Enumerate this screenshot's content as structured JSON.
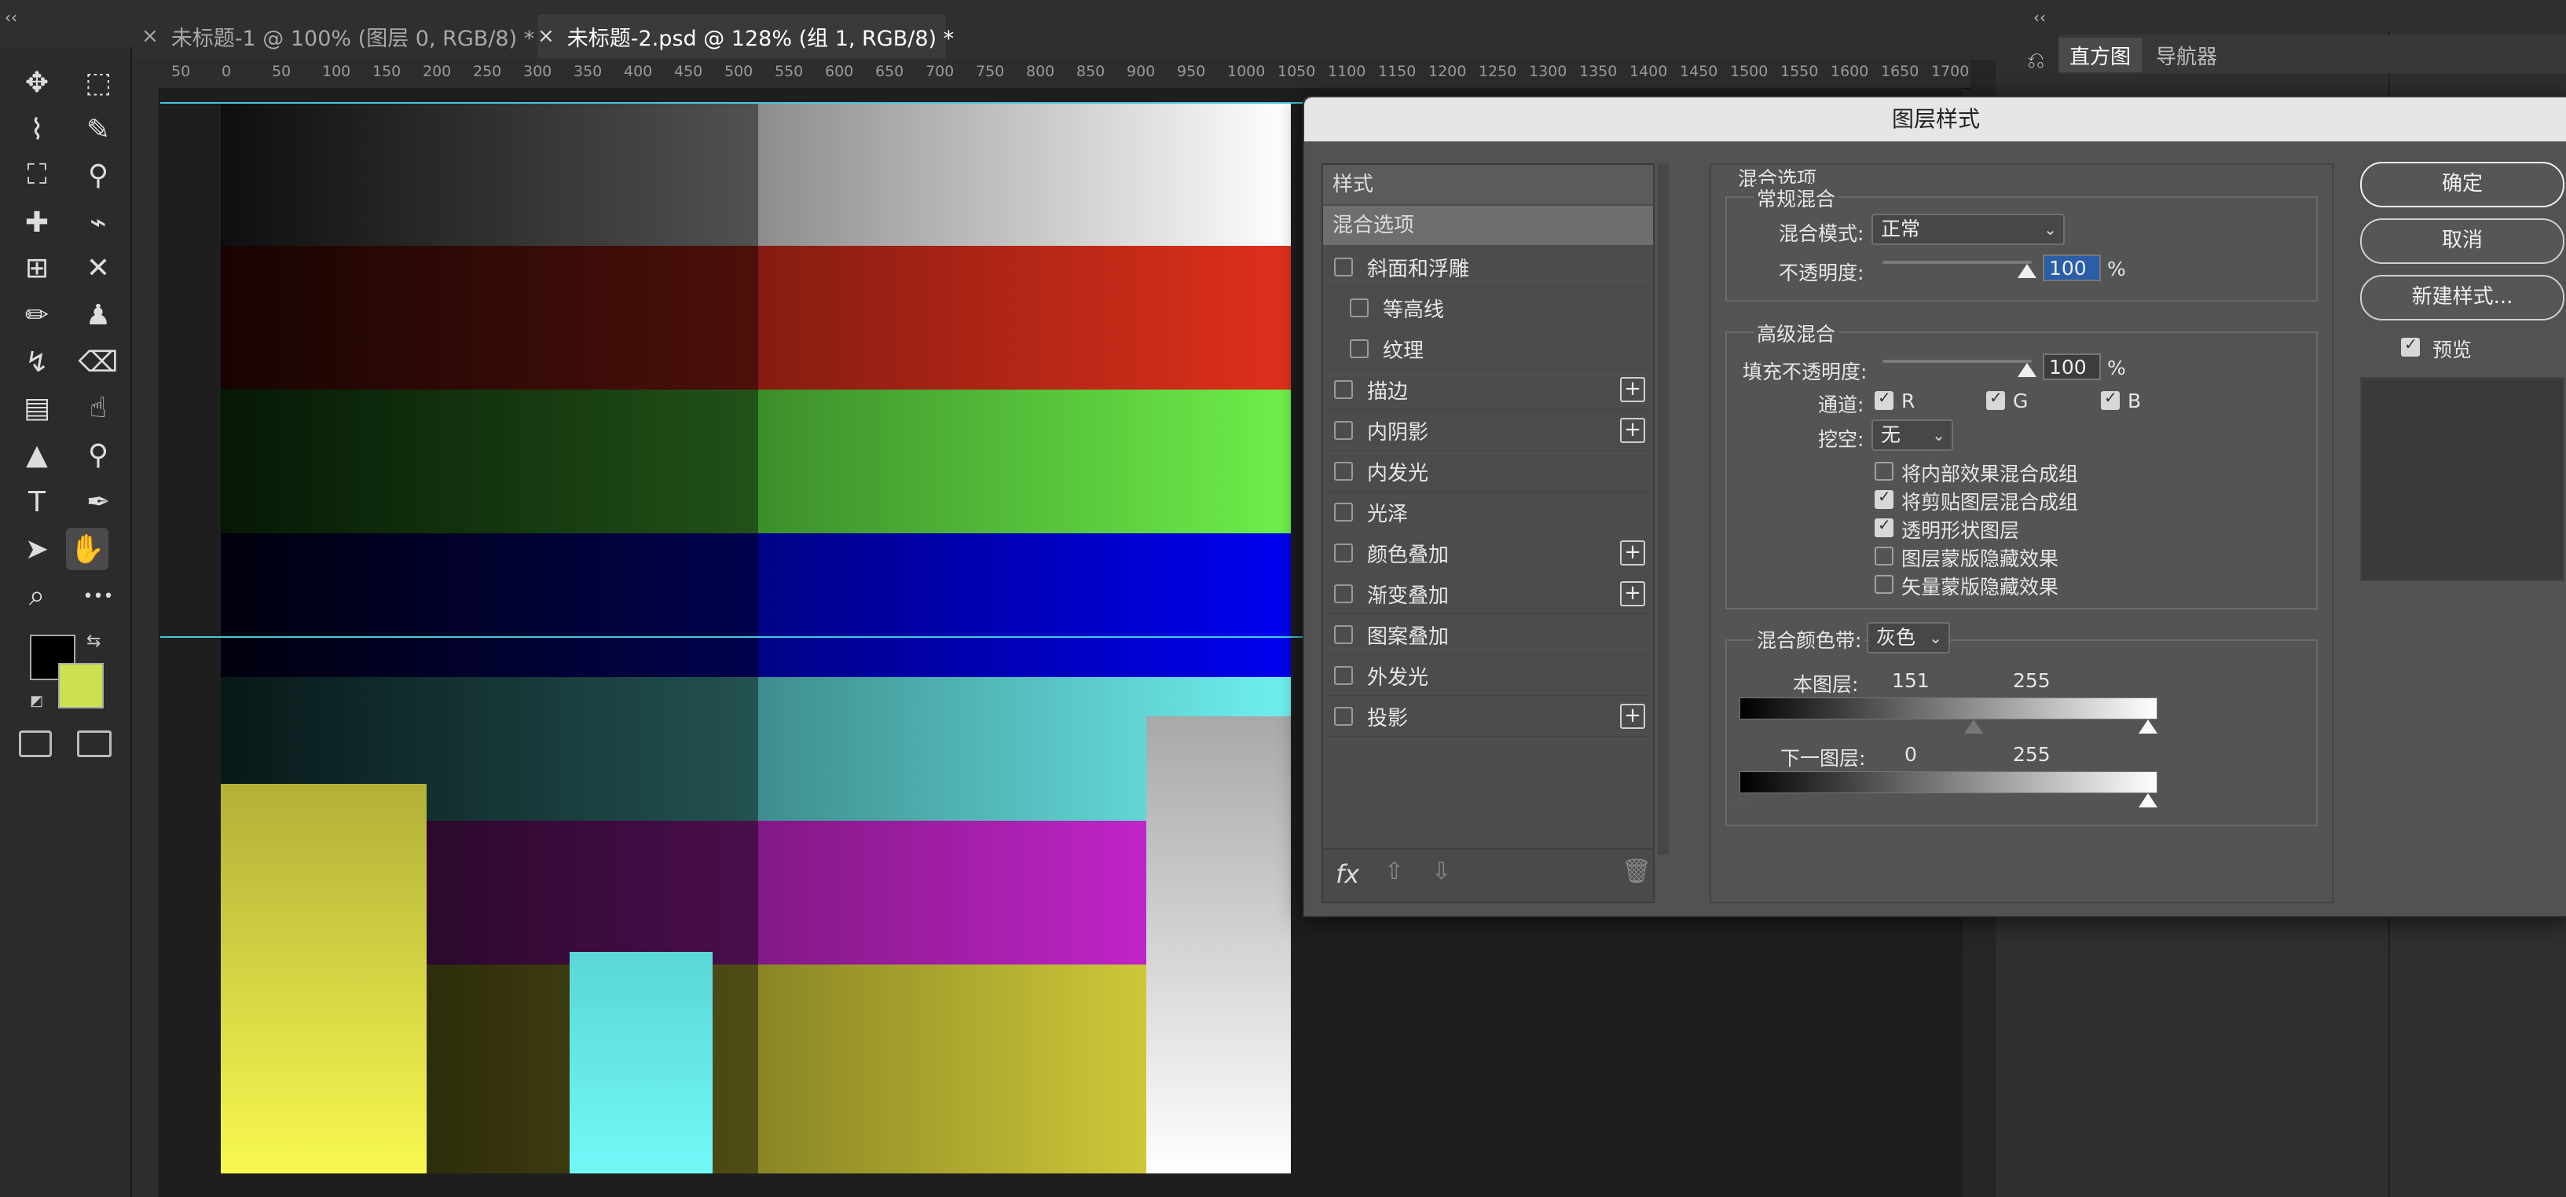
{
  "tabs": [
    {
      "label": "未标题-1 @ 100% (图层 0, RGB/8) *",
      "close": "×"
    },
    {
      "label": "未标题-2.psd @ 128% (组 1, RGB/8) *",
      "close": "×"
    }
  ],
  "collapse_glyph": "‹‹",
  "ruler_ticks": [
    "50",
    "0",
    "50",
    "100",
    "150",
    "200",
    "250",
    "300",
    "350",
    "400",
    "450",
    "500",
    "550",
    "600",
    "650",
    "700",
    "750",
    "800",
    "850",
    "900",
    "950",
    "1000",
    "1050",
    "1100",
    "1150",
    "1200",
    "1250",
    "1300",
    "1350",
    "1400",
    "1450",
    "1500",
    "1550",
    "1600",
    "1650",
    "1700"
  ],
  "panel_tabs": [
    "直方图",
    "导航器"
  ],
  "tools": [
    {
      "name": "move-tool",
      "glyph": "✥"
    },
    {
      "name": "marquee-tool",
      "glyph": "⬚"
    },
    {
      "name": "lasso-tool",
      "glyph": "⌇"
    },
    {
      "name": "quick-select-tool",
      "glyph": "✎"
    },
    {
      "name": "crop-tool",
      "glyph": "⛶"
    },
    {
      "name": "eyedropper-tool",
      "glyph": "⚲"
    },
    {
      "name": "healing-tool",
      "glyph": "✚"
    },
    {
      "name": "brush-alt-tool",
      "glyph": "⌁"
    },
    {
      "name": "content-aware-tool",
      "glyph": "⊞"
    },
    {
      "name": "transform-tool",
      "glyph": "✕"
    },
    {
      "name": "brush-tool",
      "glyph": "✏"
    },
    {
      "name": "stamp-tool",
      "glyph": "♟"
    },
    {
      "name": "history-brush-tool",
      "glyph": "↯"
    },
    {
      "name": "eraser-tool",
      "glyph": "⌫"
    },
    {
      "name": "gradient-tool",
      "glyph": "▤"
    },
    {
      "name": "smudge-tool",
      "glyph": "☝"
    },
    {
      "name": "sharpen-tool",
      "glyph": "▲"
    },
    {
      "name": "dodge-tool",
      "glyph": "⚲"
    },
    {
      "name": "type-tool",
      "glyph": "T"
    },
    {
      "name": "pen-tool",
      "glyph": "✒"
    },
    {
      "name": "path-select-tool",
      "glyph": "➤"
    },
    {
      "name": "hand-tool",
      "glyph": "✋"
    },
    {
      "name": "zoom-tool",
      "glyph": "⌕"
    },
    {
      "name": "more-tools",
      "glyph": "•••"
    }
  ],
  "colors": {
    "foreground": "#000000",
    "background": "#cde050",
    "guide": "#48c8e0"
  },
  "dialog": {
    "title": "图层样式",
    "styles_header": "样式",
    "selected": "混合选项",
    "effects": [
      {
        "label": "斜面和浮雕",
        "indent": false,
        "plus": false
      },
      {
        "label": "等高线",
        "indent": true,
        "plus": false
      },
      {
        "label": "纹理",
        "indent": true,
        "plus": false
      },
      {
        "label": "描边",
        "indent": false,
        "plus": true
      },
      {
        "label": "内阴影",
        "indent": false,
        "plus": true
      },
      {
        "label": "内发光",
        "indent": false,
        "plus": false
      },
      {
        "label": "光泽",
        "indent": false,
        "plus": false
      },
      {
        "label": "颜色叠加",
        "indent": false,
        "plus": true
      },
      {
        "label": "渐变叠加",
        "indent": false,
        "plus": true
      },
      {
        "label": "图案叠加",
        "indent": false,
        "plus": false
      },
      {
        "label": "外发光",
        "indent": false,
        "plus": false
      },
      {
        "label": "投影",
        "indent": false,
        "plus": true
      }
    ],
    "footer_fx": "fx",
    "blend_options_title": "混合选项",
    "general_title": "常规混合",
    "blend_mode_label": "混合模式:",
    "blend_mode_value": "正常",
    "opacity_label": "不透明度:",
    "opacity_value": "100",
    "percent": "%",
    "advanced_title": "高级混合",
    "fill_opacity_label": "填充不透明度:",
    "fill_opacity_value": "100",
    "channels_label": "通道:",
    "channel_r": "R",
    "channel_g": "G",
    "channel_b": "B",
    "knockout_label": "挖空:",
    "knockout_value": "无",
    "options": [
      {
        "label": "将内部效果混合成组",
        "checked": false
      },
      {
        "label": "将剪贴图层混合成组",
        "checked": true
      },
      {
        "label": "透明形状图层",
        "checked": true
      },
      {
        "label": "图层蒙版隐藏效果",
        "checked": false
      },
      {
        "label": "矢量蒙版隐藏效果",
        "checked": false
      }
    ],
    "blend_if_label": "混合颜色带:",
    "blend_if_value": "灰色",
    "this_layer_label": "本图层:",
    "this_layer_low": "151",
    "this_layer_high": "255",
    "underlying_label": "下一图层:",
    "underlying_low": "0",
    "underlying_high": "255",
    "ok": "确定",
    "cancel": "取消",
    "new_style": "新建样式...",
    "preview_label": "预览"
  }
}
